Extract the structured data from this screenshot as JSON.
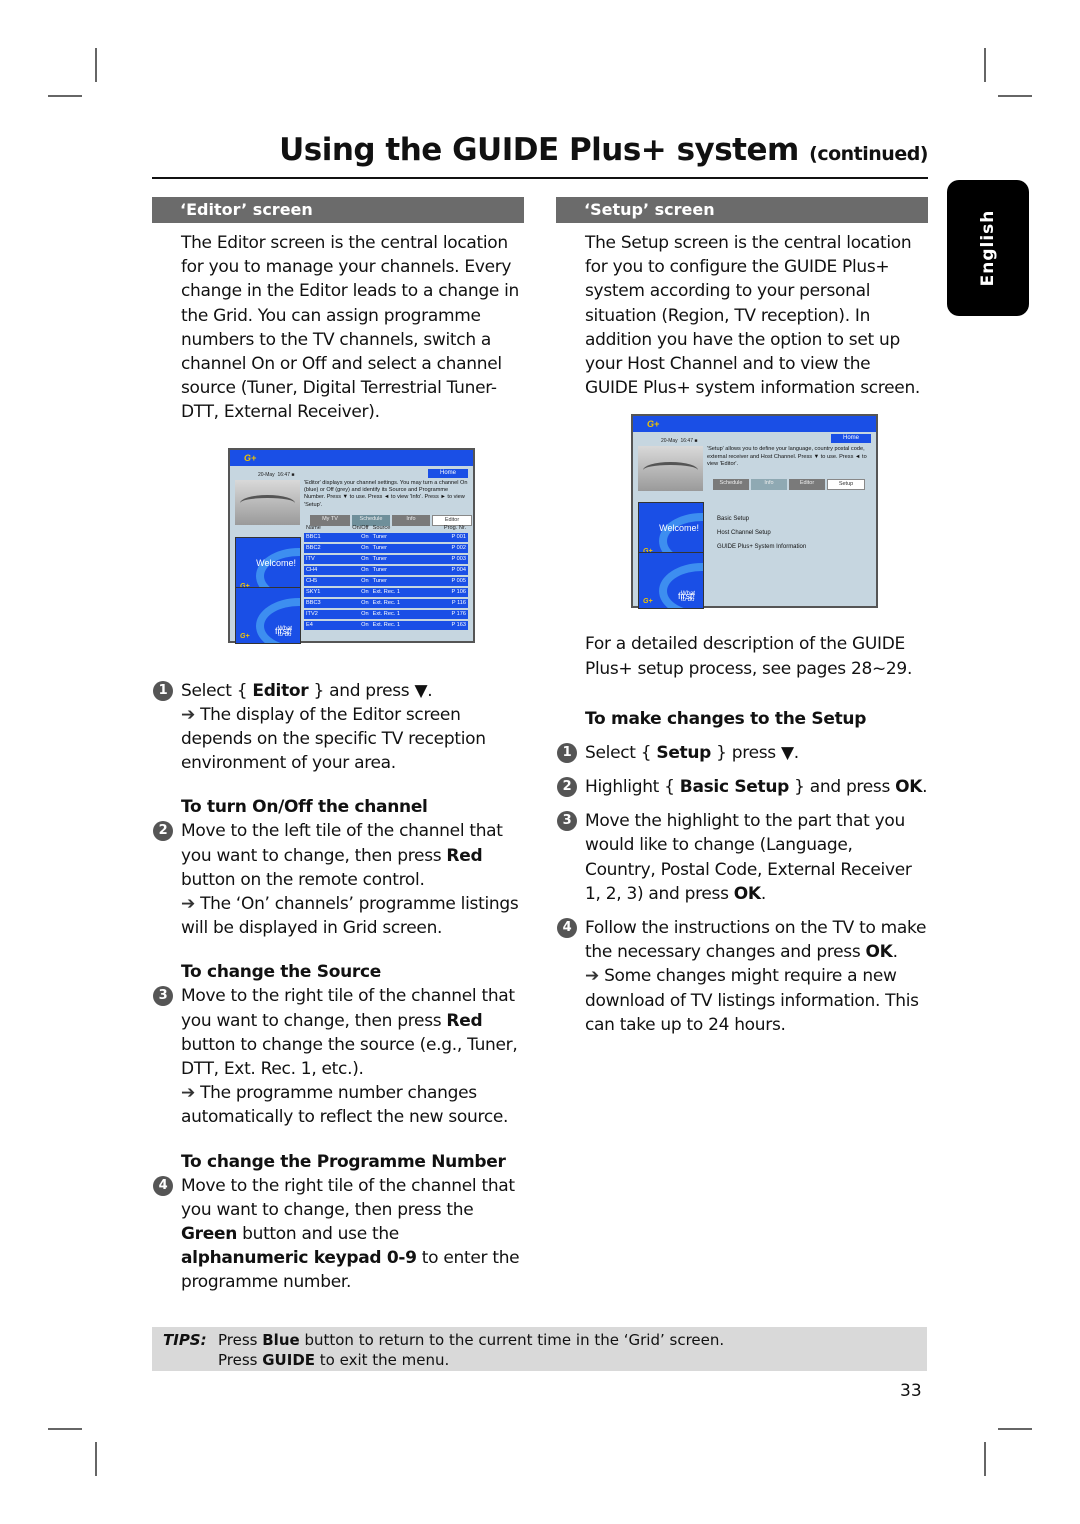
{
  "header": {
    "title": "Using the GUIDE Plus+ system",
    "title_suffix": "(continued)",
    "language_tab": "English"
  },
  "editor_section": {
    "heading": "‘Editor’ screen",
    "intro": "The Editor screen is the central location for you to manage your channels. Every change in the Editor leads to a change in the Grid. You can assign programme numbers to the TV channels, switch a channel On or Off and select a channel source (Tuner, Digital Terrestrial Tuner-DTT, External Receiver).",
    "screen": {
      "date": "20-May",
      "time": "16:47",
      "home_label": "Home",
      "description": "'Editor' displays your channel settings. You may turn a channel On (blue) or Off (grey) and identify its Source and Programme Number.  Press ▼ to use. Press ◄ to view 'Info'.  Press ► to view 'Setup'.",
      "tabs": [
        "My TV",
        "Schedule",
        "Info",
        "Editor"
      ],
      "active_tab": "Editor",
      "promo_welcome": "Welcome!",
      "promo_first_small": "What to do",
      "promo_first_big": "first!",
      "columns": [
        "Name",
        "On/Off",
        "Source",
        "Prog. Nr."
      ],
      "rows": [
        {
          "name": "BBC1",
          "state": "On",
          "source": "Tuner",
          "prog": "P 001"
        },
        {
          "name": "BBC2",
          "state": "On",
          "source": "Tuner",
          "prog": "P 002"
        },
        {
          "name": "ITV",
          "state": "On",
          "source": "Tuner",
          "prog": "P 003"
        },
        {
          "name": "CH4",
          "state": "On",
          "source": "Tuner",
          "prog": "P 004"
        },
        {
          "name": "CH5",
          "state": "On",
          "source": "Tuner",
          "prog": "P 005"
        },
        {
          "name": "SKY1",
          "state": "On",
          "source": "Ext. Rec. 1",
          "prog": "P 106"
        },
        {
          "name": "BBC3",
          "state": "On",
          "source": "Ext. Rec. 1",
          "prog": "P 116"
        },
        {
          "name": "ITV2",
          "state": "On",
          "source": "Ext. Rec. 1",
          "prog": "P 176"
        },
        {
          "name": "E4",
          "state": "On",
          "source": "Ext. Rec. 1",
          "prog": "P 163"
        }
      ]
    },
    "step1": {
      "num": "1",
      "pre": "Select { ",
      "bold": "Editor",
      "post": " } and press ▼.",
      "result": "The display of the Editor screen depends on the specific TV reception environment of your area."
    },
    "sub_onoff": "To turn On/Off the channel",
    "step2": {
      "num": "2",
      "pre": "Move to the left tile of the channel that you want to change, then press ",
      "bold": "Red",
      "post": " button on the remote control.",
      "result": "The ‘On’ channels’ programme listings will be displayed in Grid screen."
    },
    "sub_source": "To change the Source",
    "step3": {
      "num": "3",
      "pre": "Move to the right tile of the channel that you want to change, then press ",
      "bold": "Red",
      "post": " button to change the source (e.g., Tuner, DTT, Ext. Rec. 1, etc.).",
      "result": "The programme number changes automatically to reflect the new source."
    },
    "sub_prog": "To change the Programme Number",
    "step4": {
      "num": "4",
      "pre": "Move to the right tile of the channel that you want to change, then press the ",
      "bold1": "Green",
      "mid": " button and use the ",
      "bold2": "alphanumeric keypad 0-9",
      "post": " to enter the programme number."
    }
  },
  "setup_section": {
    "heading": "‘Setup’ screen",
    "intro": "The Setup screen is the central location for you to configure the GUIDE Plus+ system according to your personal situation (Region, TV reception). In addition you have the option to set up your Host Channel and to view the GUIDE Plus+ system information screen.",
    "screen": {
      "date": "20-May",
      "time": "16:47",
      "home_label": "Home",
      "description": "'Setup' allows you to define your language, country postal code, external receiver and Host Channel. Press ▼ to use. Press ◄ to view 'Editor'.",
      "tabs": [
        "Schedule",
        "Info",
        "Editor",
        "Setup"
      ],
      "active_tab": "Setup",
      "menu": [
        "Basic Setup",
        "Host Channel Setup",
        "GUIDE Plus+ System Information"
      ],
      "promo_welcome": "Welcome!",
      "promo_first_small": "What to do",
      "promo_first_big": "first!"
    },
    "detail_note": "For a detailed description of the GUIDE Plus+ setup process, see pages 28~29.",
    "sub_changes": "To make changes to the Setup",
    "step1": {
      "num": "1",
      "pre": "Select { ",
      "bold": "Setup",
      "post": " } press ▼."
    },
    "step2": {
      "num": "2",
      "pre": "Highlight { ",
      "bold": "Basic Setup",
      "mid": " } and press ",
      "bold2": "OK",
      "post": "."
    },
    "step3": {
      "num": "3",
      "pre": "Move the highlight to the part that you would like to change (Language, Country, Postal Code, External Receiver 1, 2, 3) and press ",
      "bold": "OK",
      "post": "."
    },
    "step4": {
      "num": "4",
      "pre": "Follow the instructions on the TV to make the necessary changes and press ",
      "bold": "OK",
      "post": ".",
      "result": "Some changes might require a new download of TV listings information. This can take up to 24 hours."
    }
  },
  "tips": {
    "label": "TIPS:",
    "line1_pre": "Press ",
    "line1_bold": "Blue",
    "line1_post": " button to return to the current time in the ‘Grid’ screen.",
    "line2_pre": "Press ",
    "line2_bold": "GUIDE",
    "line2_post": " to exit the menu."
  },
  "page_number": "33"
}
